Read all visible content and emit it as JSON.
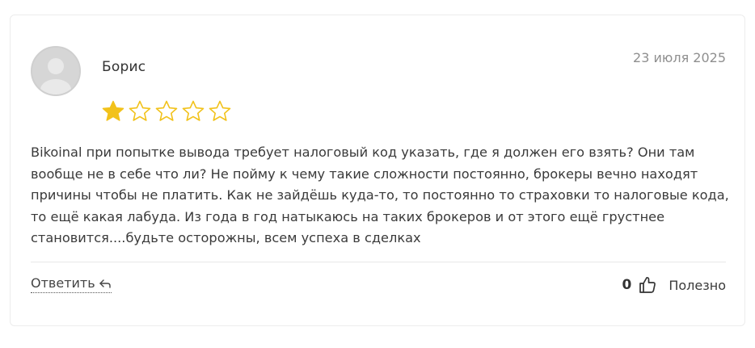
{
  "review": {
    "author": "Борис",
    "date": "23 июля 2025",
    "rating": 1,
    "rating_max": 5,
    "text": "Bikoinal при попытке вывода требует налоговый код указать, где я должен его взять? Они там вообще не в себе что ли? Не пойму к чему такие сложности постоянно, брокеры вечно находят причины чтобы не платить. Как не зайдёшь куда-то, то постоянно то страховки то налоговые кода, то ещё какая лабуда. Из года в год натыкаюсь на таких брокеров и от этого ещё грустнее становится....будьте осторожны, всем успеха в сделках"
  },
  "actions": {
    "reply_label": "Ответить",
    "reply_icon": "reply-arrow-icon",
    "helpful_count": "0",
    "helpful_icon": "thumbs-up-icon",
    "helpful_label": "Полезно"
  },
  "colors": {
    "star_filled": "#f2c21b",
    "star_outline": "#f2c21b",
    "date": "#8f8f8f",
    "text": "#3a3a3a"
  }
}
